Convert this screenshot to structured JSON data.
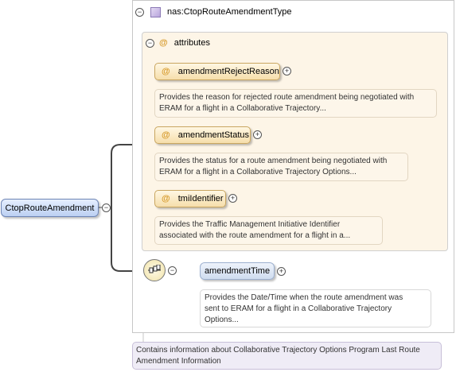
{
  "root": {
    "label": "CtopRouteAmendment",
    "description": "Contains information about Collaborative Trajectory Options Program Last Route Amendment Information"
  },
  "type": {
    "title": "nas:CtopRouteAmendmentType",
    "toggle": "−"
  },
  "attributes": {
    "title": "attributes",
    "toggle": "−",
    "items": [
      {
        "label": "amendmentRejectReason",
        "description_line1": "Provides the reason for rejected route amendment being negotiated with",
        "description_line2": "ERAM for a flight in a Collaborative Trajectory..."
      },
      {
        "label": "amendmentStatus",
        "description_line1": "Provides the status for a route amendment being negotiated with",
        "description_line2": "ERAM for a flight in a Collaborative Trajectory Options..."
      },
      {
        "label": "tmiIdentifier",
        "description_line1": "Provides the Traffic Management Initiative Identifier",
        "description_line2": "associated with the route amendment for a flight in a..."
      }
    ]
  },
  "sequence": {
    "toggle": "−",
    "element": {
      "label": "amendmentTime",
      "description_line1": "Provides the Date/Time when the route amendment was",
      "description_line2": "sent to ERAM for a flight in a Collaborative Trajectory",
      "description_line3": "Options..."
    }
  },
  "symbols": {
    "at": "@",
    "plus": "+",
    "minus": "−"
  }
}
